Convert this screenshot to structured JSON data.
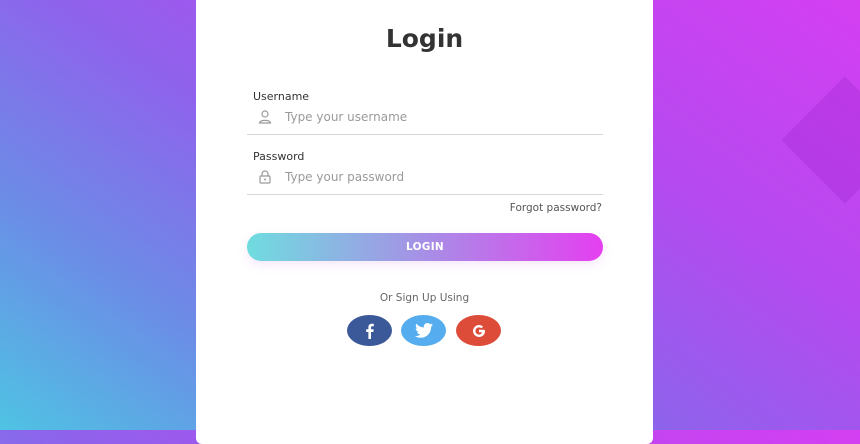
{
  "login": {
    "title": "Login",
    "username": {
      "label": "Username",
      "placeholder": "Type your username",
      "value": ""
    },
    "password": {
      "label": "Password",
      "placeholder": "Type your password",
      "value": ""
    },
    "forgot_link": "Forgot password?",
    "submit_label": "LOGIN",
    "alt_signup_label": "Or Sign Up Using",
    "social": [
      {
        "name": "facebook",
        "icon": "facebook-icon",
        "color": "#3b5998"
      },
      {
        "name": "twitter",
        "icon": "twitter-icon",
        "color": "#55acee"
      },
      {
        "name": "google",
        "icon": "google-icon",
        "color": "#dd4b39"
      }
    ]
  },
  "colors": {
    "gradient_start": "#4fc3e3",
    "gradient_end": "#d43ff2",
    "button_start": "#6fdcdf",
    "button_end": "#e53ff0"
  }
}
